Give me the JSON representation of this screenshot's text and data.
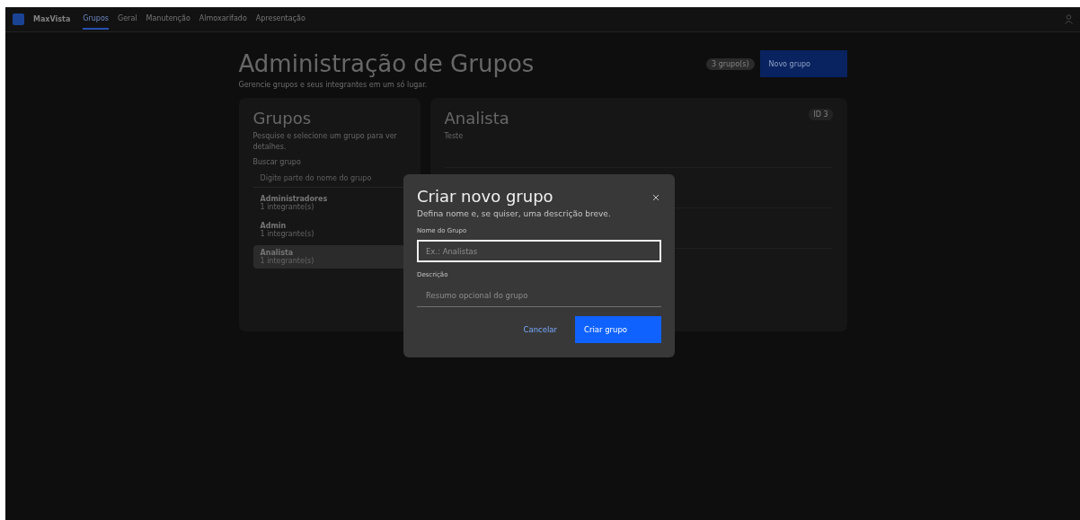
{
  "nav": {
    "brand": "MaxVista",
    "items": [
      {
        "label": "Grupos",
        "selected": true
      },
      {
        "label": "Geral",
        "selected": false
      },
      {
        "label": "Manutenção",
        "selected": false
      },
      {
        "label": "Almoxarifado",
        "selected": false
      },
      {
        "label": "Apresentação",
        "selected": false
      }
    ]
  },
  "header": {
    "title": "Administração de Grupos",
    "subtitle": "Gerencie grupos e seus integrantes em um só lugar.",
    "count_badge": "3 grupo(s)",
    "new_button": "Novo grupo"
  },
  "groups_panel": {
    "title": "Grupos",
    "description": "Pesquise e selecione um grupo para ver detalhes.",
    "search_label": "Buscar grupo",
    "search_placeholder": "Digite parte do nome do grupo",
    "items": [
      {
        "name": "Administradores",
        "members": "1 integrante(s)",
        "selected": false
      },
      {
        "name": "Admin",
        "members": "1 integrante(s)",
        "selected": false
      },
      {
        "name": "Analista",
        "members": "1 integrante(s)",
        "selected": true
      }
    ]
  },
  "detail_panel": {
    "title": "Analista",
    "description": "Teste",
    "badge": "ID 3"
  },
  "dialog": {
    "title": "Criar novo grupo",
    "subtitle": "Defina nome e, se quiser, uma descrição breve.",
    "name_label": "Nome do Grupo",
    "name_placeholder": "Ex.: Analistas",
    "description_label": "Descrição",
    "description_placeholder": "Resumo opcional do grupo",
    "cancel": "Cancelar",
    "submit": "Criar grupo"
  }
}
